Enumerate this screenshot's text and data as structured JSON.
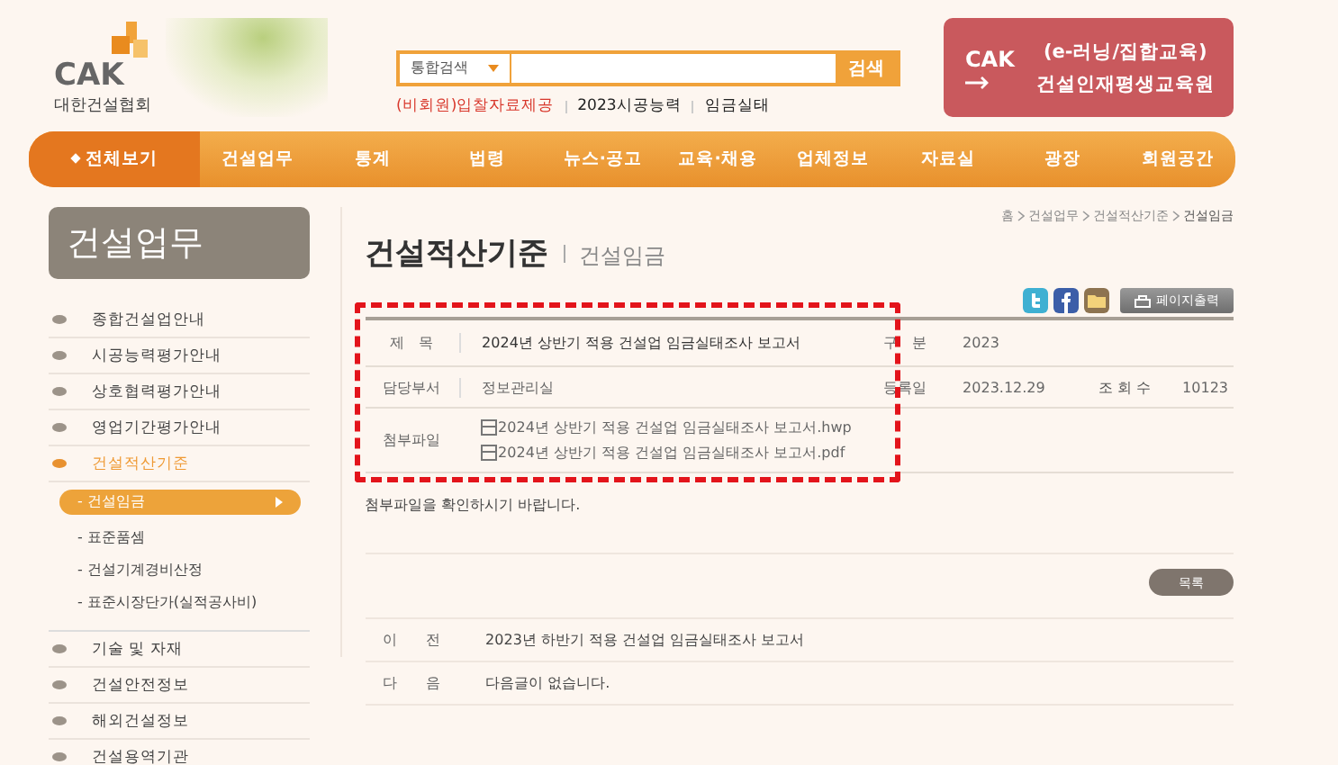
{
  "header": {
    "logo": {
      "mark": "CAK",
      "name": "대한건설협회"
    },
    "search": {
      "scope": "통합검색",
      "button": "검색"
    },
    "quick_links": [
      {
        "label": "(비회원)입찰자료제공",
        "color": "#d8372b"
      },
      {
        "label": "2023시공능력",
        "color": "#222222"
      },
      {
        "label": "임금실태",
        "color": "#222222"
      }
    ],
    "banner": {
      "mark": "CAK",
      "line1": "(e-러닝/집합교육)",
      "line2": "건설인재평생교육원"
    }
  },
  "nav": [
    {
      "label": "전체보기",
      "selected": true
    },
    {
      "label": "건설업무",
      "selected": false
    },
    {
      "label": "통계",
      "selected": false
    },
    {
      "label": "법령",
      "selected": false
    },
    {
      "label": "뉴스·공고",
      "selected": false
    },
    {
      "label": "교육·채용",
      "selected": false
    },
    {
      "label": "업체정보",
      "selected": false
    },
    {
      "label": "자료실",
      "selected": false
    },
    {
      "label": "광장",
      "selected": false
    },
    {
      "label": "회원공간",
      "selected": false
    }
  ],
  "sidebar": {
    "title": "건설업무",
    "items": [
      {
        "label": "종합건설업안내",
        "selected": false
      },
      {
        "label": "시공능력평가안내",
        "selected": false
      },
      {
        "label": "상호협력평가안내",
        "selected": false
      },
      {
        "label": "영업기간평가안내",
        "selected": false
      },
      {
        "label": "건설적산기준",
        "selected": true,
        "children": [
          {
            "label": "- 건설임금",
            "selected": true
          },
          {
            "label": "- 표준품셈",
            "selected": false
          },
          {
            "label": "- 건설기계경비산정",
            "selected": false
          },
          {
            "label": "- 표준시장단가(실적공사비)",
            "selected": false
          }
        ]
      },
      {
        "label": "기술 및 자재",
        "selected": false
      },
      {
        "label": "건설안전정보",
        "selected": false
      },
      {
        "label": "해외건설정보",
        "selected": false
      },
      {
        "label": "건설용역기관",
        "selected": false
      }
    ]
  },
  "breadcrumb": [
    "홈",
    "건설업무",
    "건설적산기준",
    "건설임금"
  ],
  "page": {
    "title": "건설적산기준",
    "subtitle": "건설임금"
  },
  "toolbar": {
    "print": "페이지출력"
  },
  "post": {
    "highlighted": true,
    "title_label": "제　목",
    "title": "2024년 상반기 적용 건설업 임금실태조사 보고서",
    "category_label": "구　분",
    "category": "2023",
    "dept_label": "담당부서",
    "dept": "정보관리실",
    "date_label": "등록일",
    "date": "2023.12.29",
    "views_label": "조 회 수",
    "views": "10123",
    "files_label": "첨부파일",
    "files": [
      "2024년 상반기 적용 건설업 임금실태조사 보고서.hwp",
      "2024년 상반기 적용 건설업 임금실태조사 보고서.pdf"
    ],
    "body": "첨부파일을 확인하시기 바랍니다."
  },
  "list_button": "목록",
  "adjacent": [
    {
      "label": "이　　전",
      "text": "2023년 하반기 적용 건설업 임금실태조사 보고서"
    },
    {
      "label": "다　　음",
      "text": "다음글이 없습니다."
    }
  ]
}
